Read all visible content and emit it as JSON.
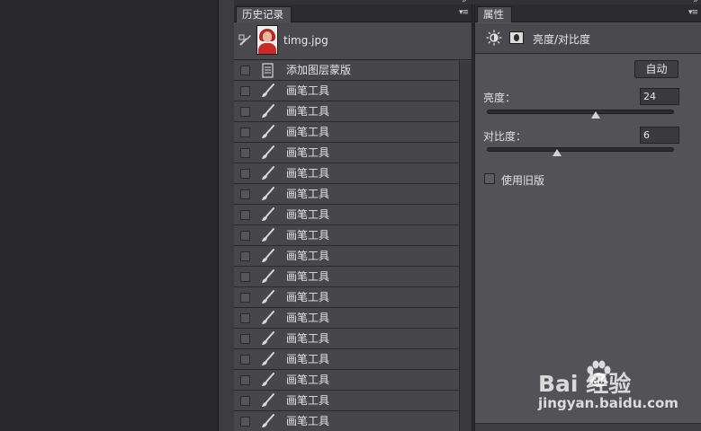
{
  "history_panel": {
    "tab_label": "历史记录",
    "menu_icon": "panel-menu-icon",
    "snapshot": {
      "name": "timg.jpg"
    },
    "items": [
      {
        "label": "添加图层蒙版",
        "icon": "layer-mask-icon"
      },
      {
        "label": "画笔工具",
        "icon": "brush-icon"
      },
      {
        "label": "画笔工具",
        "icon": "brush-icon"
      },
      {
        "label": "画笔工具",
        "icon": "brush-icon"
      },
      {
        "label": "画笔工具",
        "icon": "brush-icon"
      },
      {
        "label": "画笔工具",
        "icon": "brush-icon"
      },
      {
        "label": "画笔工具",
        "icon": "brush-icon"
      },
      {
        "label": "画笔工具",
        "icon": "brush-icon"
      },
      {
        "label": "画笔工具",
        "icon": "brush-icon"
      },
      {
        "label": "画笔工具",
        "icon": "brush-icon"
      },
      {
        "label": "画笔工具",
        "icon": "brush-icon"
      },
      {
        "label": "画笔工具",
        "icon": "brush-icon"
      },
      {
        "label": "画笔工具",
        "icon": "brush-icon"
      },
      {
        "label": "画笔工具",
        "icon": "brush-icon"
      },
      {
        "label": "画笔工具",
        "icon": "brush-icon"
      },
      {
        "label": "画笔工具",
        "icon": "brush-icon"
      },
      {
        "label": "画笔工具",
        "icon": "brush-icon"
      },
      {
        "label": "画笔工具",
        "icon": "brush-icon"
      }
    ]
  },
  "properties_panel": {
    "tab_label": "属性",
    "adjustment_title": "亮度/对比度",
    "auto_button": "自动",
    "brightness": {
      "label": "亮度：",
      "value": "24",
      "min": -150,
      "max": 150
    },
    "contrast": {
      "label": "对比度：",
      "value": "6",
      "min": -50,
      "max": 100
    },
    "legacy_label": "使用旧版",
    "legacy_checked": false
  },
  "watermark": {
    "brand": "Bai 经验",
    "url": "jingyan.baidu.com"
  },
  "colors": {
    "panel_bg": "#535256",
    "history_bg": "#47464a",
    "canvas_bg": "#28272b"
  }
}
